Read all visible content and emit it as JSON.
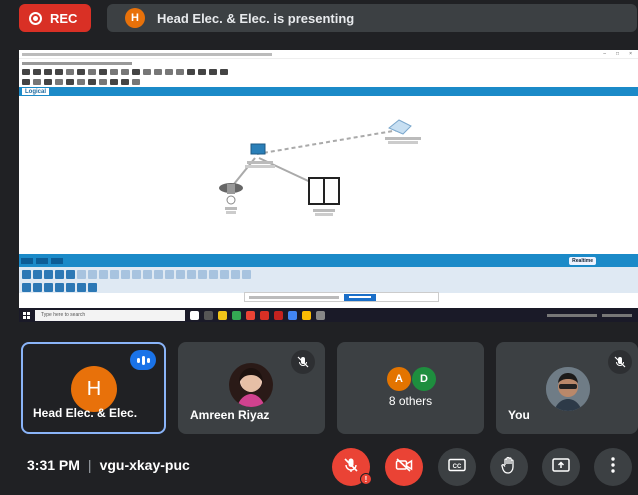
{
  "top": {
    "rec_label": "REC",
    "presenter_initial": "H",
    "presenting_text": "Head Elec. & Elec. is presenting"
  },
  "shared": {
    "tab_logical": "Logical",
    "realtime_label": "Realtime",
    "taskbar_search": "Type here to search"
  },
  "participants": [
    {
      "name": "Head Elec. & Elec.",
      "initial": "H",
      "speaking": true
    },
    {
      "name": "Amreen Riyaz",
      "muted": true
    },
    {
      "name": "8 others",
      "initials": [
        "A",
        "D"
      ],
      "colors": [
        "#e37400",
        "#1e8e3e"
      ]
    },
    {
      "name": "You",
      "muted": true
    }
  ],
  "meeting": {
    "time": "3:31 PM",
    "code": "vgu-xkay-puc"
  },
  "colors": {
    "rec": "#d93025",
    "avatar_orange": "#e8710a",
    "active_border": "#8ab4f8",
    "speak_blue": "#1a73e8",
    "end_red": "#ea4335"
  },
  "icons": [
    "rec-icon",
    "mic-off-icon",
    "camera-off-icon",
    "captions-icon",
    "raise-hand-icon",
    "present-screen-icon",
    "more-options-icon"
  ]
}
